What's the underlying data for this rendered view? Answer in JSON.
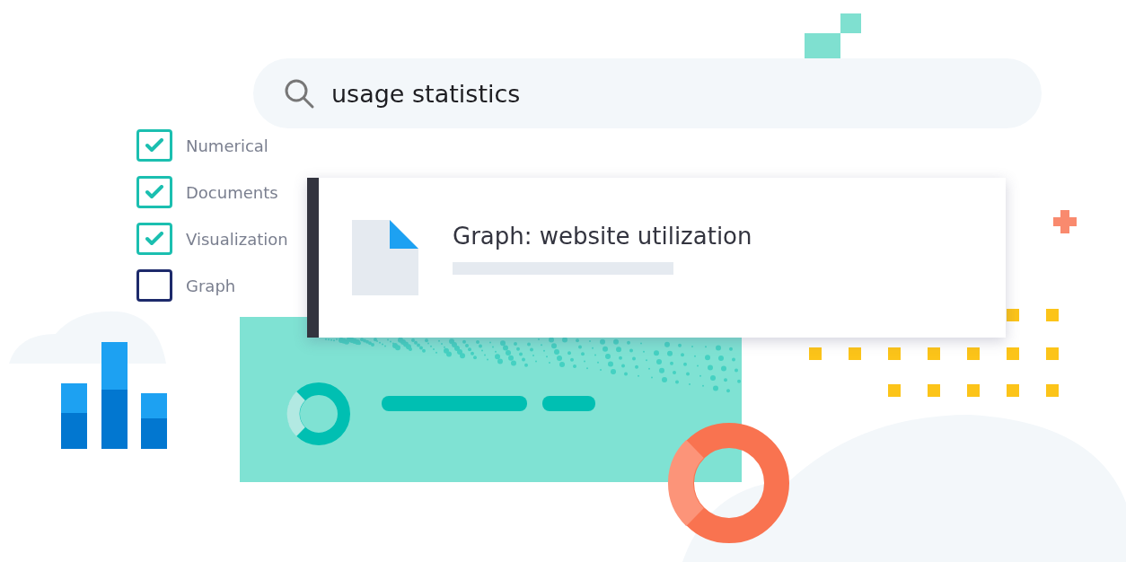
{
  "search": {
    "value": "usage statistics"
  },
  "filters": [
    {
      "label": "Numerical",
      "checked": true
    },
    {
      "label": "Documents",
      "checked": true
    },
    {
      "label": "Visualization",
      "checked": true
    },
    {
      "label": "Graph",
      "checked": false
    }
  ],
  "result": {
    "title": "Graph: website utilization"
  }
}
